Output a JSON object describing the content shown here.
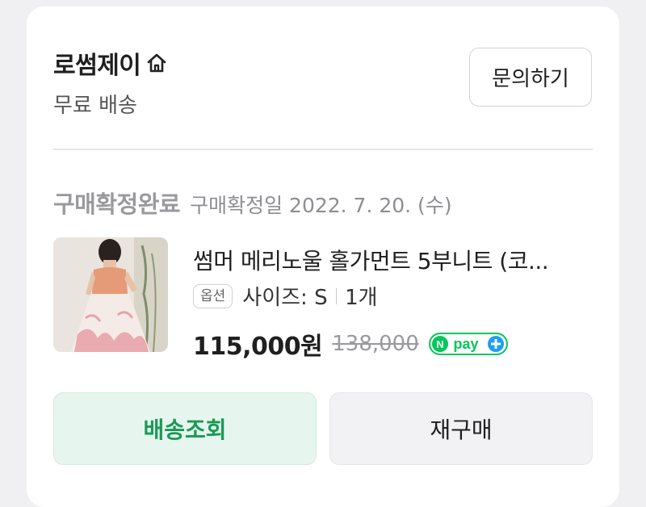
{
  "seller": {
    "name": "로썸제이",
    "shipping": "무료 배송",
    "inquiry_label": "문의하기"
  },
  "order": {
    "status": "구매확정완료",
    "confirm_date": "구매확정일 2022. 7. 20. (수)"
  },
  "product": {
    "title": "썸머 메리노울 홀가먼트 5부니트 (코...",
    "option_badge": "옵션",
    "option_value": "사이즈: S",
    "quantity": "1개",
    "sale_price": "115,000원",
    "original_price": "138,000",
    "payment_badge": "pay"
  },
  "actions": {
    "track_label": "배송조회",
    "rebuy_label": "재구매"
  },
  "colors": {
    "track_text": "#1a9a55",
    "npay_green": "#03c75a",
    "npay_blue": "#1e9df3"
  }
}
